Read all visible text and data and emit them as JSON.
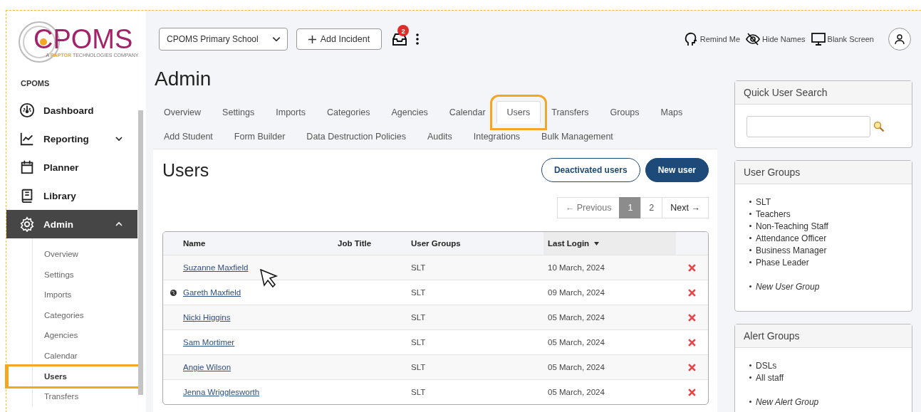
{
  "logo": {
    "wordmark": "CPOMS",
    "tagline_lead": "A",
    "tagline_brand": "RAPTOR",
    "tagline_tail": "TECHNOLOGIES COMPANY"
  },
  "sidebar": {
    "heading": "CPOMS",
    "items": [
      {
        "label": "Dashboard",
        "kind": "link",
        "selected": false
      },
      {
        "label": "Reporting",
        "kind": "group",
        "selected": false,
        "expanded": false
      },
      {
        "label": "Planner",
        "kind": "link",
        "selected": false
      },
      {
        "label": "Library",
        "kind": "link",
        "selected": false
      },
      {
        "label": "Admin",
        "kind": "group",
        "selected": true,
        "expanded": true,
        "children": [
          {
            "label": "Overview",
            "selected": false,
            "highlighted": false
          },
          {
            "label": "Settings",
            "selected": false,
            "highlighted": false
          },
          {
            "label": "Imports",
            "selected": false,
            "highlighted": false
          },
          {
            "label": "Categories",
            "selected": false,
            "highlighted": false
          },
          {
            "label": "Agencies",
            "selected": false,
            "highlighted": false
          },
          {
            "label": "Calendar",
            "selected": false,
            "highlighted": false
          },
          {
            "label": "Users",
            "selected": true,
            "highlighted": true
          },
          {
            "label": "Transfers",
            "selected": false,
            "highlighted": false
          }
        ]
      }
    ]
  },
  "header": {
    "school": "CPOMS Primary School",
    "add_incident": "Add Incident",
    "inbox_count": "2",
    "tools": [
      "Remind Me",
      "Hide Names",
      "Blank Screen"
    ]
  },
  "page": {
    "title": "Admin",
    "tabs": [
      [
        {
          "label": "Overview",
          "selected": false,
          "highlighted": false
        },
        {
          "label": "Settings",
          "selected": false,
          "highlighted": false
        },
        {
          "label": "Imports",
          "selected": false,
          "highlighted": false
        },
        {
          "label": "Categories",
          "selected": false,
          "highlighted": false
        },
        {
          "label": "Agencies",
          "selected": false,
          "highlighted": false
        },
        {
          "label": "Calendar",
          "selected": false,
          "highlighted": false
        },
        {
          "label": "Users",
          "selected": true,
          "highlighted": true
        },
        {
          "label": "Transfers",
          "selected": false,
          "highlighted": false
        },
        {
          "label": "Groups",
          "selected": false,
          "highlighted": false
        },
        {
          "label": "Maps",
          "selected": false,
          "highlighted": false
        }
      ],
      [
        {
          "label": "Add Student",
          "selected": false,
          "highlighted": false
        },
        {
          "label": "Form Builder",
          "selected": false,
          "highlighted": false
        },
        {
          "label": "Data Destruction Policies",
          "selected": false,
          "highlighted": false
        },
        {
          "label": "Audits",
          "selected": false,
          "highlighted": false
        },
        {
          "label": "Integrations",
          "selected": false,
          "highlighted": false
        },
        {
          "label": "Bulk Management",
          "selected": false,
          "highlighted": false
        }
      ]
    ]
  },
  "users": {
    "title": "Users",
    "buttons": [
      "Deactivated users",
      "New user"
    ],
    "pagination": [
      {
        "label": "← Previous",
        "kind": "nav",
        "selected": false
      },
      {
        "label": "1",
        "kind": "page",
        "selected": true
      },
      {
        "label": "2",
        "kind": "page",
        "selected": false
      },
      {
        "label": "Next →",
        "kind": "nav",
        "selected": false
      }
    ],
    "columns": [
      {
        "label": "Name",
        "sorted": false
      },
      {
        "label": "Job Title",
        "sorted": false
      },
      {
        "label": "User Groups",
        "sorted": false
      },
      {
        "label": "Last Login",
        "sorted": true
      }
    ],
    "rows": [
      {
        "name": "Suzanne Maxfield",
        "external": false,
        "groups": "SLT",
        "last_login": "10 March, 2024"
      },
      {
        "name": "Gareth Maxfield",
        "external": true,
        "groups": "SLT",
        "last_login": "09 March, 2024"
      },
      {
        "name": "Nicki Higgins",
        "external": false,
        "groups": "SLT",
        "last_login": "05 March, 2024"
      },
      {
        "name": "Sam Mortimer",
        "external": false,
        "groups": "SLT",
        "last_login": "05 March, 2024"
      },
      {
        "name": "Angie Wilson",
        "external": false,
        "groups": "SLT",
        "last_login": "05 March, 2024"
      },
      {
        "name": "Jenna Wrigglesworth",
        "external": false,
        "groups": "SLT",
        "last_login": "05 March, 2024"
      }
    ]
  },
  "panels": [
    {
      "title": "Quick User Search",
      "kind": "search"
    },
    {
      "title": "User Groups",
      "kind": "list",
      "items": [
        "SLT",
        "Teachers",
        "Non-Teaching Staff",
        "Attendance Officer",
        "Business Manager",
        "Phase Leader"
      ],
      "new_item": "New User Group"
    },
    {
      "title": "Alert Groups",
      "kind": "list",
      "items": [
        "DSLs",
        "All staff"
      ],
      "new_item": "New Alert Group"
    }
  ]
}
